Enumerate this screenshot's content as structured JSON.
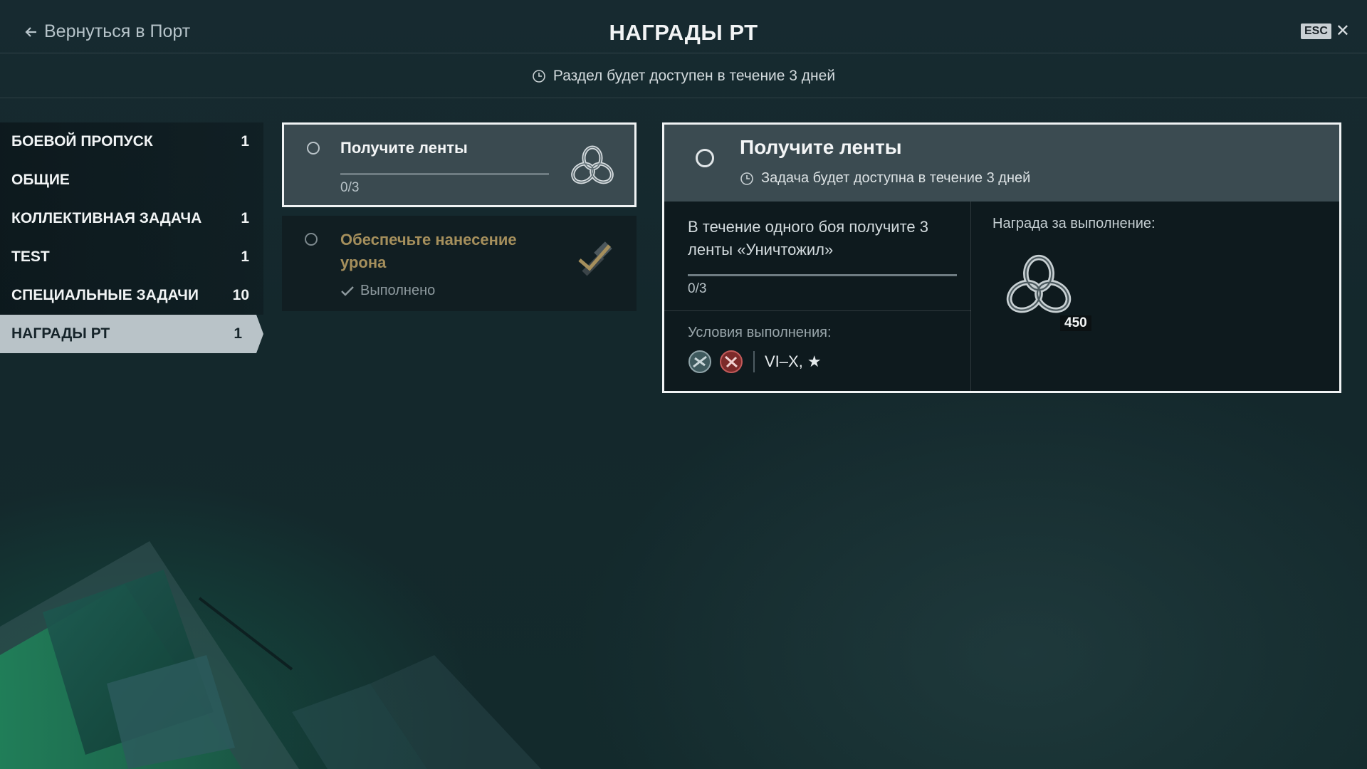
{
  "header": {
    "back_label": "Вернуться в Порт",
    "title": "НАГРАДЫ РТ",
    "esc_key": "ESC"
  },
  "availability": {
    "text": "Раздел будет доступен в течение 3 дней"
  },
  "sidebar": {
    "items": [
      {
        "label": "БОЕВОЙ ПРОПУСК",
        "count": "1"
      },
      {
        "label": "ОБЩИЕ",
        "count": ""
      },
      {
        "label": "КОЛЛЕКТИВНАЯ ЗАДАЧА",
        "count": "1"
      },
      {
        "label": "TEST",
        "count": "1"
      },
      {
        "label": "СПЕЦИАЛЬНЫЕ ЗАДАЧИ",
        "count": "10"
      },
      {
        "label": "НАГРАДЫ РТ",
        "count": "1",
        "active": true
      }
    ]
  },
  "tasks": [
    {
      "title": "Получите ленты",
      "progress_text": "0/3",
      "progress": 0,
      "icon": "chain-link-icon",
      "selected": true
    },
    {
      "title": "Обеспечьте нанесение урона",
      "status": "Выполнено",
      "icon": "hammer-check-icon",
      "completed": true
    }
  ],
  "detail": {
    "title": "Получите ленты",
    "availability": "Задача будет доступна в течение 3 дней",
    "description": "В течение одного боя получите 3 ленты «Уничтожил»",
    "progress_text": "0/3",
    "progress": 0,
    "conditions_label": "Условия выполнения:",
    "condition_icons": [
      "ship-class-icon",
      "ship-type-icon"
    ],
    "tiers": "VI–X, ★",
    "reward_label": "Награда за выполнение:",
    "reward": {
      "icon": "chain-link-icon",
      "count": "450"
    }
  },
  "colors": {
    "background": "#13262a",
    "panel_header": "#3b4b51",
    "active_tab": "#b9c3c8",
    "completed_title": "#a58f5c"
  }
}
